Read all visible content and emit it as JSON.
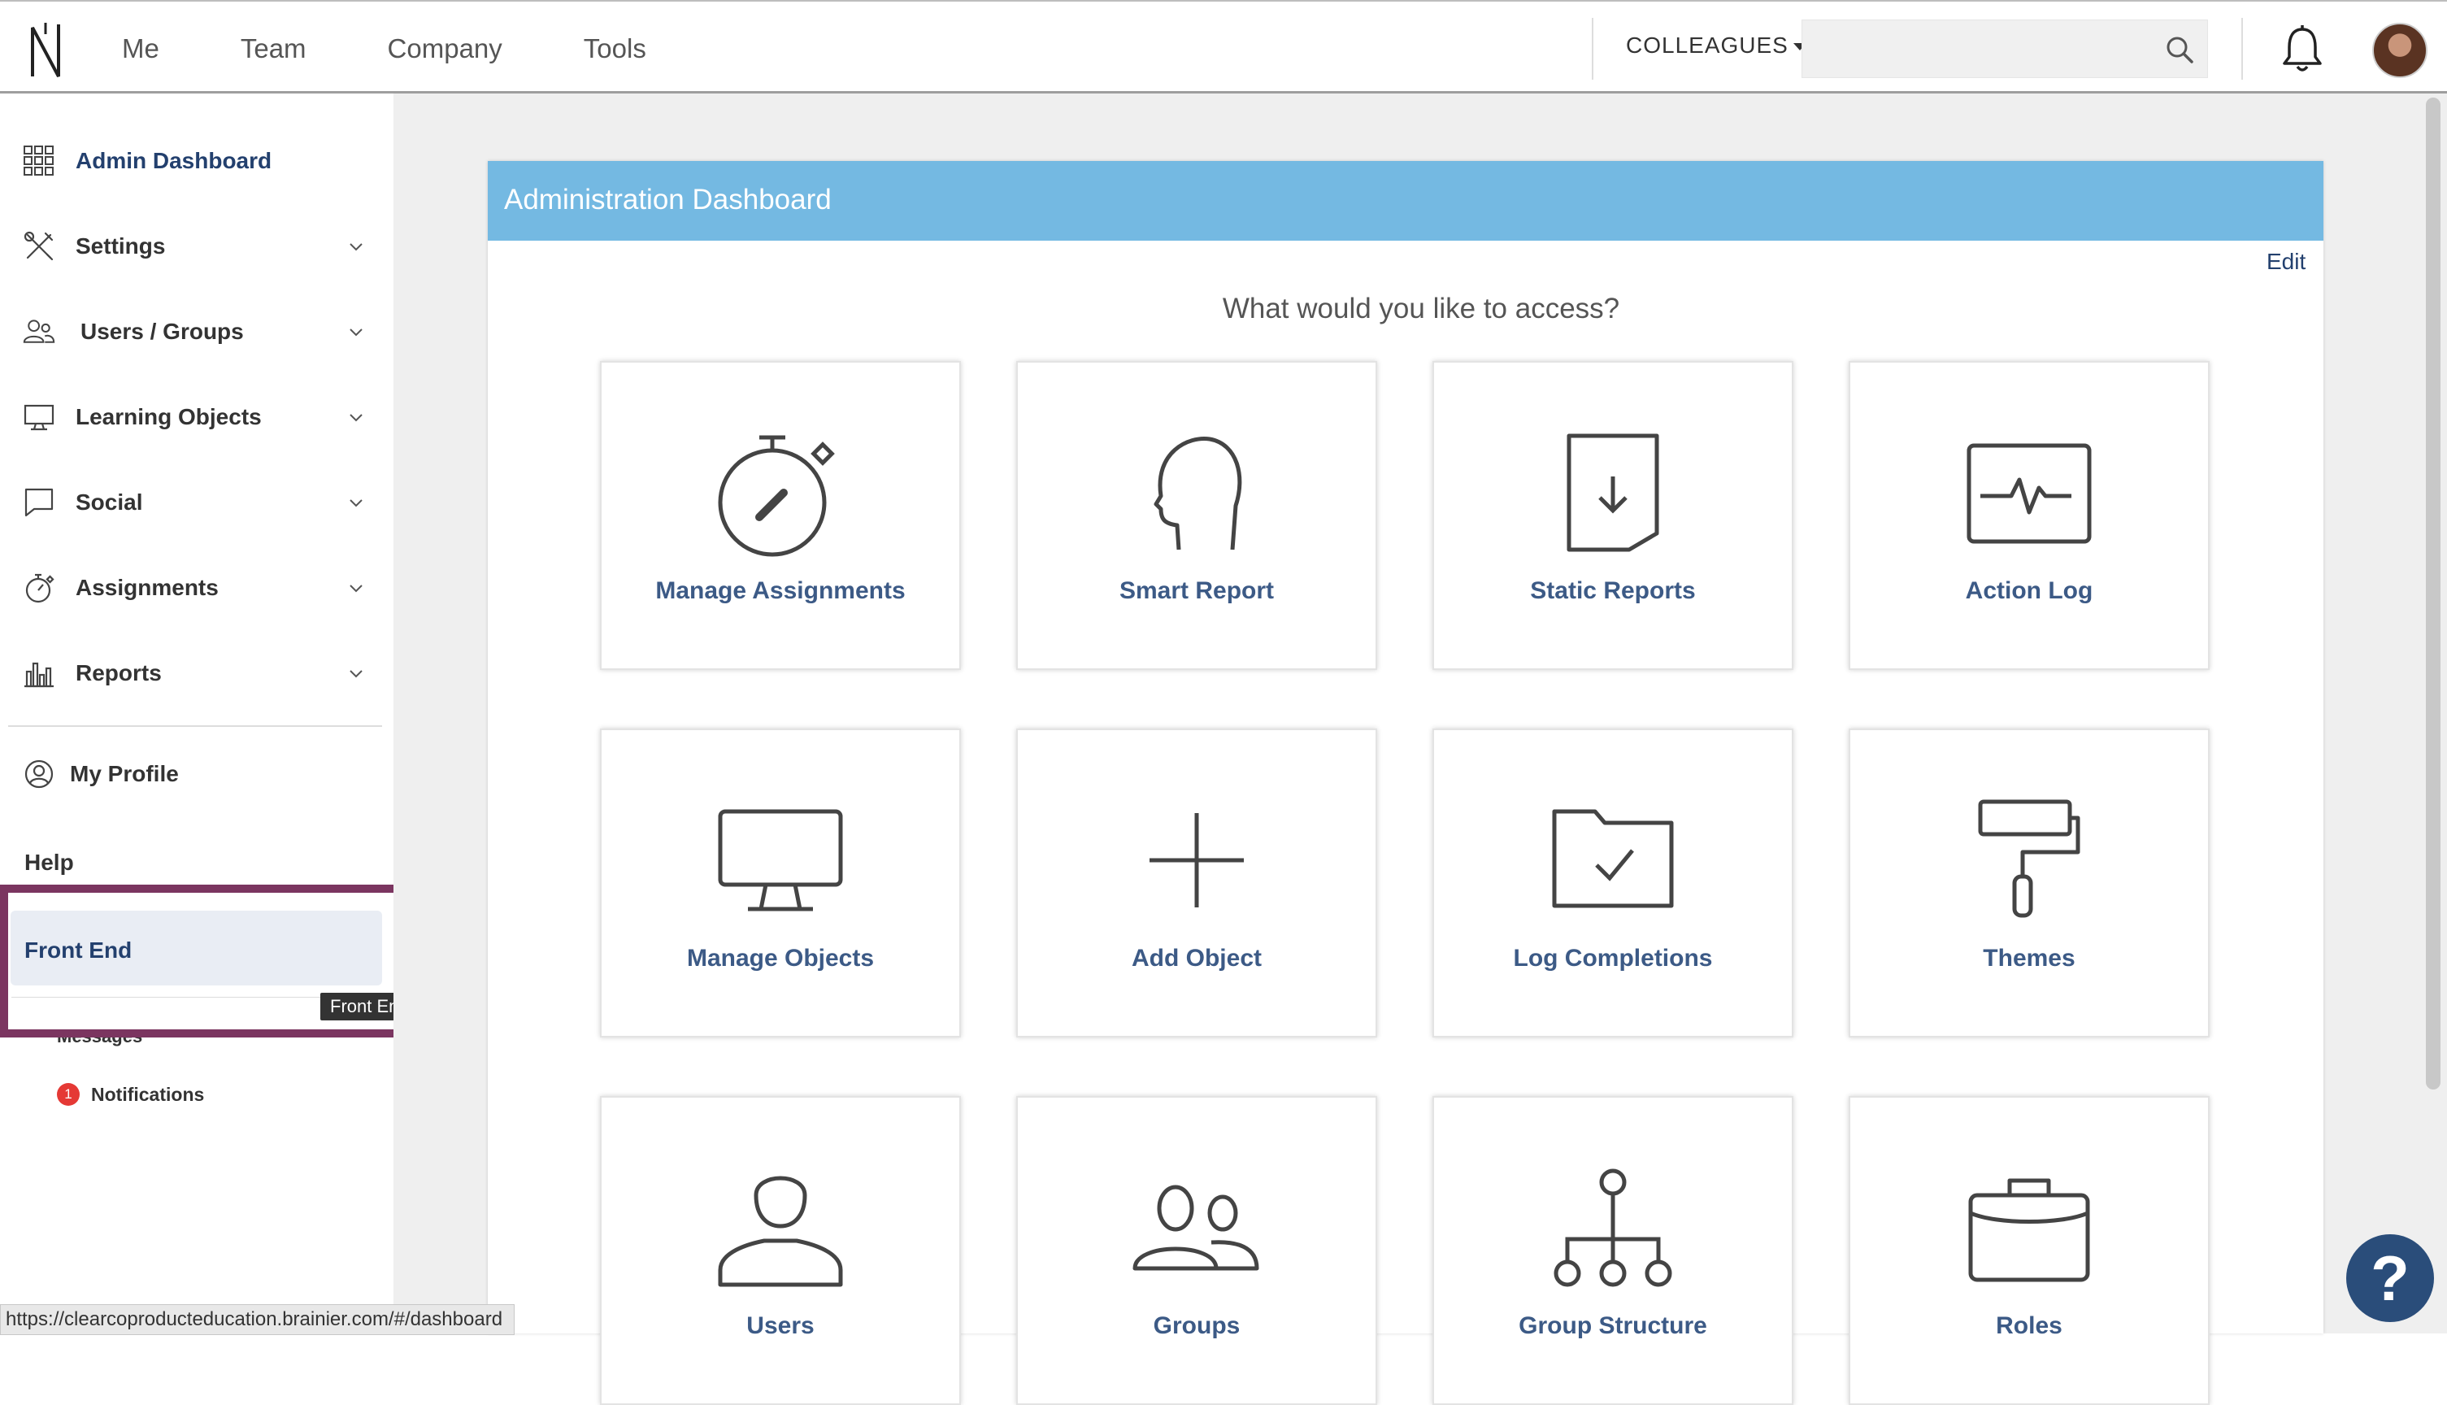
{
  "topnav": {
    "items": [
      "Me",
      "Team",
      "Company",
      "Tools"
    ],
    "colleagues_label": "COLLEAGUES",
    "search_placeholder": ""
  },
  "sidebar": {
    "items": [
      {
        "label": "Admin Dashboard",
        "icon": "grid-icon"
      },
      {
        "label": "Settings",
        "icon": "tools-icon"
      },
      {
        "label": "Users / Groups",
        "icon": "users-icon"
      },
      {
        "label": "Learning Objects",
        "icon": "monitor-icon"
      },
      {
        "label": "Social",
        "icon": "chat-icon"
      },
      {
        "label": "Assignments",
        "icon": "stopwatch-icon"
      },
      {
        "label": "Reports",
        "icon": "bar-chart-icon"
      }
    ],
    "profile_label": "My Profile",
    "help_label": "Help",
    "front_end_label": "Front End",
    "tooltip": "Front End",
    "messages_label": "Messages",
    "notifications_label": "Notifications",
    "notifications_count": "1"
  },
  "main": {
    "panel_title": "Administration Dashboard",
    "edit_label": "Edit",
    "question": "What would you like to access?",
    "tiles": [
      {
        "label": "Manage Assignments",
        "icon": "stopwatch-icon"
      },
      {
        "label": "Smart Report",
        "icon": "head-icon"
      },
      {
        "label": "Static Reports",
        "icon": "download-doc-icon"
      },
      {
        "label": "Action Log",
        "icon": "pulse-icon"
      },
      {
        "label": "Manage Objects",
        "icon": "monitor-icon"
      },
      {
        "label": "Add Object",
        "icon": "plus-icon"
      },
      {
        "label": "Log Completions",
        "icon": "folder-check-icon"
      },
      {
        "label": "Themes",
        "icon": "paint-roller-icon"
      },
      {
        "label": "Users",
        "icon": "user-icon"
      },
      {
        "label": "Groups",
        "icon": "group-icon"
      },
      {
        "label": "Group Structure",
        "icon": "hierarchy-icon"
      },
      {
        "label": "Roles",
        "icon": "briefcase-icon"
      }
    ]
  },
  "help_fab": "?",
  "status_url": "https://clearcoproducteducation.brainier.com/#/dashboard",
  "colors": {
    "header_blue": "#74b9e2",
    "link_navy": "#23406e",
    "tile_label": "#3c5a86",
    "highlight": "#7b3560",
    "badge_red": "#e53935",
    "fab": "#2a4d7a"
  }
}
